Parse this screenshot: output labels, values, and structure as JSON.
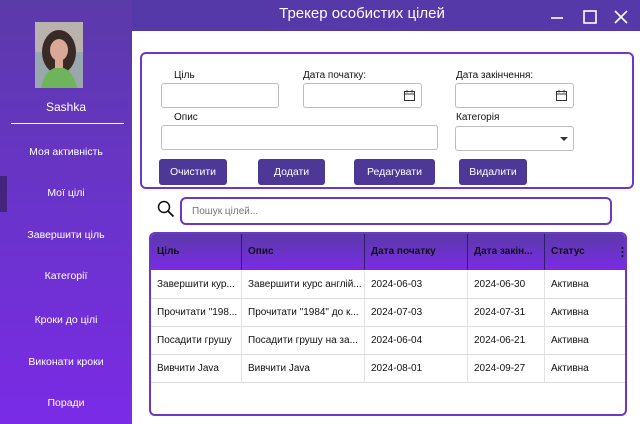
{
  "window": {
    "title": "Трекер особистих цілей"
  },
  "colors": {
    "accent": "#6d37c8",
    "button": "#4d3797",
    "sidebar_top": "#5b3aa9",
    "sidebar_bottom": "#7a2be6"
  },
  "user": {
    "name": "Sashka"
  },
  "sidebar": {
    "items": [
      {
        "label": "Моя активність"
      },
      {
        "label": "Мої цілі"
      },
      {
        "label": "Завершити ціль"
      },
      {
        "label": "Категорії"
      },
      {
        "label": "Кроки до цілі"
      },
      {
        "label": "Виконати кроки"
      },
      {
        "label": "Поради"
      }
    ]
  },
  "form": {
    "goal_label": "Ціль",
    "goal_value": "",
    "start_date_label": "Дата початку:",
    "end_date_label": "Дата закінчення:",
    "description_label": "Опис",
    "description_value": "",
    "category_label": "Категорія",
    "buttons": {
      "clear": "Очистити",
      "add": "Додати",
      "edit": "Редагувати",
      "delete": "Видалити"
    }
  },
  "search": {
    "placeholder": "Пошук цілей..."
  },
  "table": {
    "columns": [
      "Ціль",
      "Опис",
      "Дата початку",
      "Дата закін...",
      "Статус"
    ],
    "rows": [
      [
        "Завершити кур...",
        "Завершити курс англій...",
        "2024-06-03",
        "2024-06-30",
        "Активна"
      ],
      [
        "Прочитати \"198...",
        "Прочитати \"1984\" до к...",
        "2024-07-03",
        "2024-07-31",
        "Активна"
      ],
      [
        "Посадити грушу",
        "Посадити грушу на за...",
        "2024-06-04",
        "2024-06-21",
        "Активна"
      ],
      [
        "Вивчити Java",
        "Вивчити Java",
        "2024-08-01",
        "2024-09-27",
        "Активна"
      ]
    ]
  }
}
